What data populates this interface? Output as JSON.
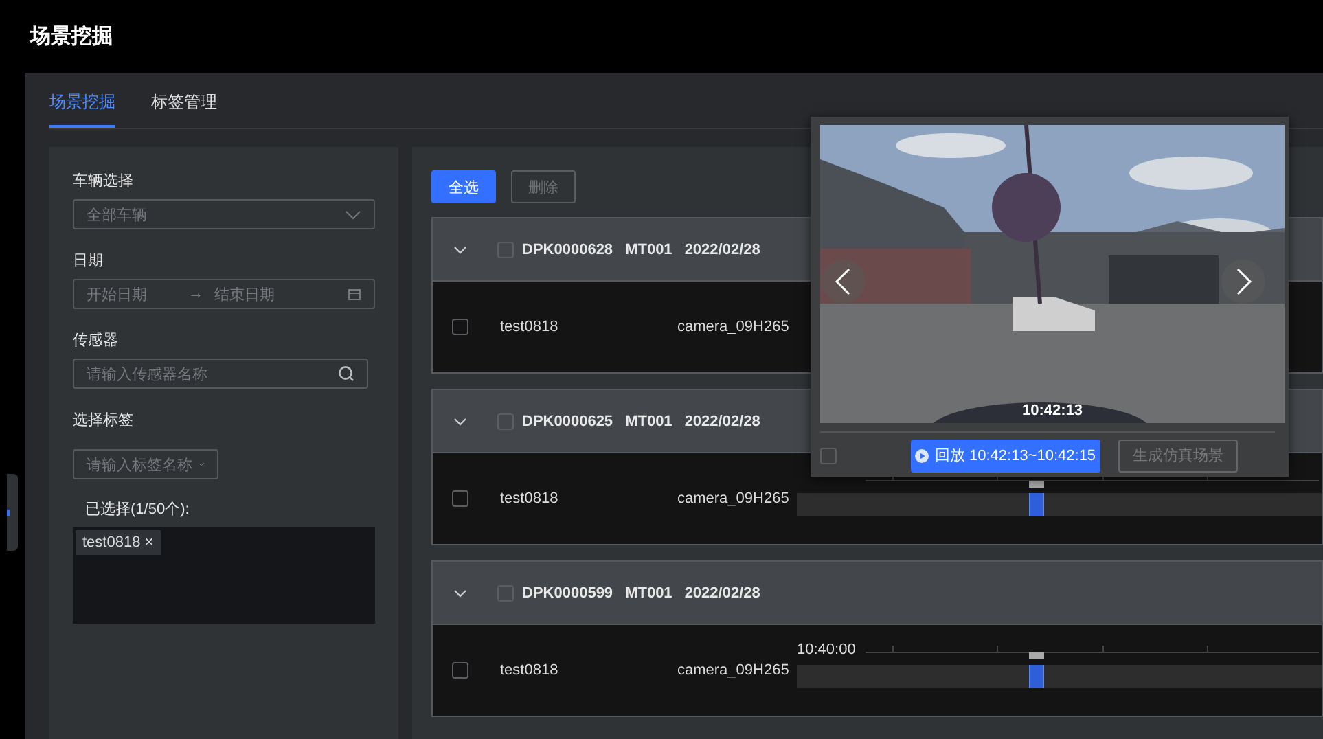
{
  "app_title": "场景挖掘",
  "tabs": [
    {
      "label": "场景挖掘",
      "selected": true
    },
    {
      "label": "标签管理",
      "selected": false
    }
  ],
  "filters": {
    "vehicle": {
      "label": "车辆选择",
      "placeholder": "全部车辆"
    },
    "date": {
      "label": "日期",
      "start_placeholder": "开始日期",
      "separator": "→",
      "end_placeholder": "结束日期"
    },
    "sensor": {
      "label": "传感器",
      "placeholder": "请输入传感器名称"
    },
    "tag": {
      "label": "选择标签",
      "placeholder": "请输入标签名称"
    },
    "selected_label": "已选择(1/50个):",
    "selected_tags": [
      {
        "label": "test0818",
        "remove": "×"
      }
    ]
  },
  "toolbar": {
    "select_all": "全选",
    "delete": {
      "label": "删除",
      "disabled": true
    }
  },
  "groups": [
    {
      "expanded": true,
      "checked": false,
      "code": "DPK0000628",
      "vehicle": "MT001",
      "date": "2022/02/28",
      "rows": [
        {
          "checked": false,
          "tag": "test0818",
          "sensor": "camera_09H265"
        }
      ]
    },
    {
      "expanded": true,
      "checked": false,
      "code": "DPK0000625",
      "vehicle": "MT001",
      "date": "2022/02/28",
      "rows": [
        {
          "checked": false,
          "tag": "test0818",
          "sensor": "camera_09H265",
          "timeline": {
            "level": 0.45
          }
        }
      ]
    },
    {
      "expanded": true,
      "checked": false,
      "code": "DPK0000599",
      "vehicle": "MT001",
      "date": "2022/02/28",
      "rows": [
        {
          "checked": false,
          "tag": "test0818",
          "sensor": "camera_09H265",
          "timeline": {
            "start": "10:40:00",
            "level": 0.45
          }
        }
      ]
    }
  ],
  "preview": {
    "timestamp": "10:42:13",
    "checked": false,
    "replay_button": "回放  10:42:13~10:42:15",
    "generate_button": {
      "label": "生成仿真场景",
      "disabled": true
    }
  }
}
